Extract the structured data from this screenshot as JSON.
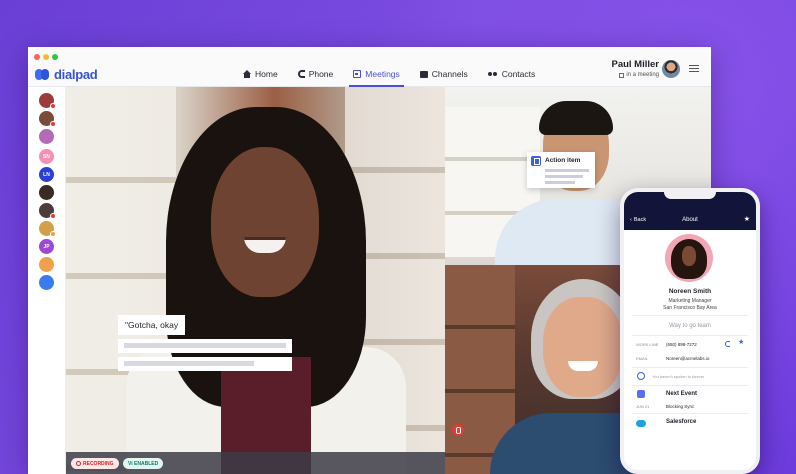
{
  "app": {
    "brand": "dialpad"
  },
  "nav": {
    "items": [
      {
        "label": "Home",
        "icon": "home-icon",
        "active": false
      },
      {
        "label": "Phone",
        "icon": "phone-icon",
        "active": false
      },
      {
        "label": "Meetings",
        "icon": "calendar-icon",
        "active": true
      },
      {
        "label": "Channels",
        "icon": "chat-icon",
        "active": false
      },
      {
        "label": "Contacts",
        "icon": "contacts-icon",
        "active": false
      }
    ]
  },
  "user": {
    "name": "Paul Miller",
    "status": "in a meeting"
  },
  "sidebar": {
    "avatars": [
      {
        "initials": "",
        "color": "#9b3b3b",
        "badge": true
      },
      {
        "initials": "",
        "color": "#7a4b3a",
        "badge": true
      },
      {
        "initials": "",
        "color": "#b56ab8",
        "badge": false
      },
      {
        "initials": "SN",
        "color": "#f58fb5",
        "badge": false
      },
      {
        "initials": "LN",
        "color": "#2b3fd6",
        "badge": false
      },
      {
        "initials": "",
        "color": "#3a2a24",
        "badge": false
      },
      {
        "initials": "",
        "color": "#4b3b3b",
        "badge": true
      },
      {
        "initials": "",
        "color": "#d2a04a",
        "badge": true
      },
      {
        "initials": "JP",
        "color": "#9b4bd1",
        "badge": false
      },
      {
        "initials": "",
        "color": "#f0a04a",
        "badge": false
      },
      {
        "initials": "",
        "color": "#3b7bf0",
        "badge": false
      }
    ]
  },
  "main_video": {
    "transcript_quote": "\"Gotcha, okay",
    "recording_label": "RECORDING",
    "vi_label": "Vi ENABLED"
  },
  "action_card": {
    "label": "Action item"
  },
  "phone": {
    "back_label": "Back",
    "title": "About",
    "contact": {
      "name": "Noreen Smith",
      "role": "Marketing Manager",
      "location": "San Francisco Bay Area"
    },
    "note": "Way to go team",
    "rows": [
      {
        "label": "WORK LINE",
        "value": "(650) 898-7272"
      },
      {
        "label": "EMAIL",
        "value": "Noreen@acmelabs.io"
      }
    ],
    "gray_note": "You haven't spoken in forever",
    "next_event": "Next Event",
    "event_label": "JUN 21",
    "event_value": "Blocking Sync",
    "salesforce": "Salesforce"
  },
  "colors": {
    "brand": "#3554d1",
    "accent": "#4b4fd8",
    "background": "#6a3fd6",
    "record": "#e53935"
  }
}
